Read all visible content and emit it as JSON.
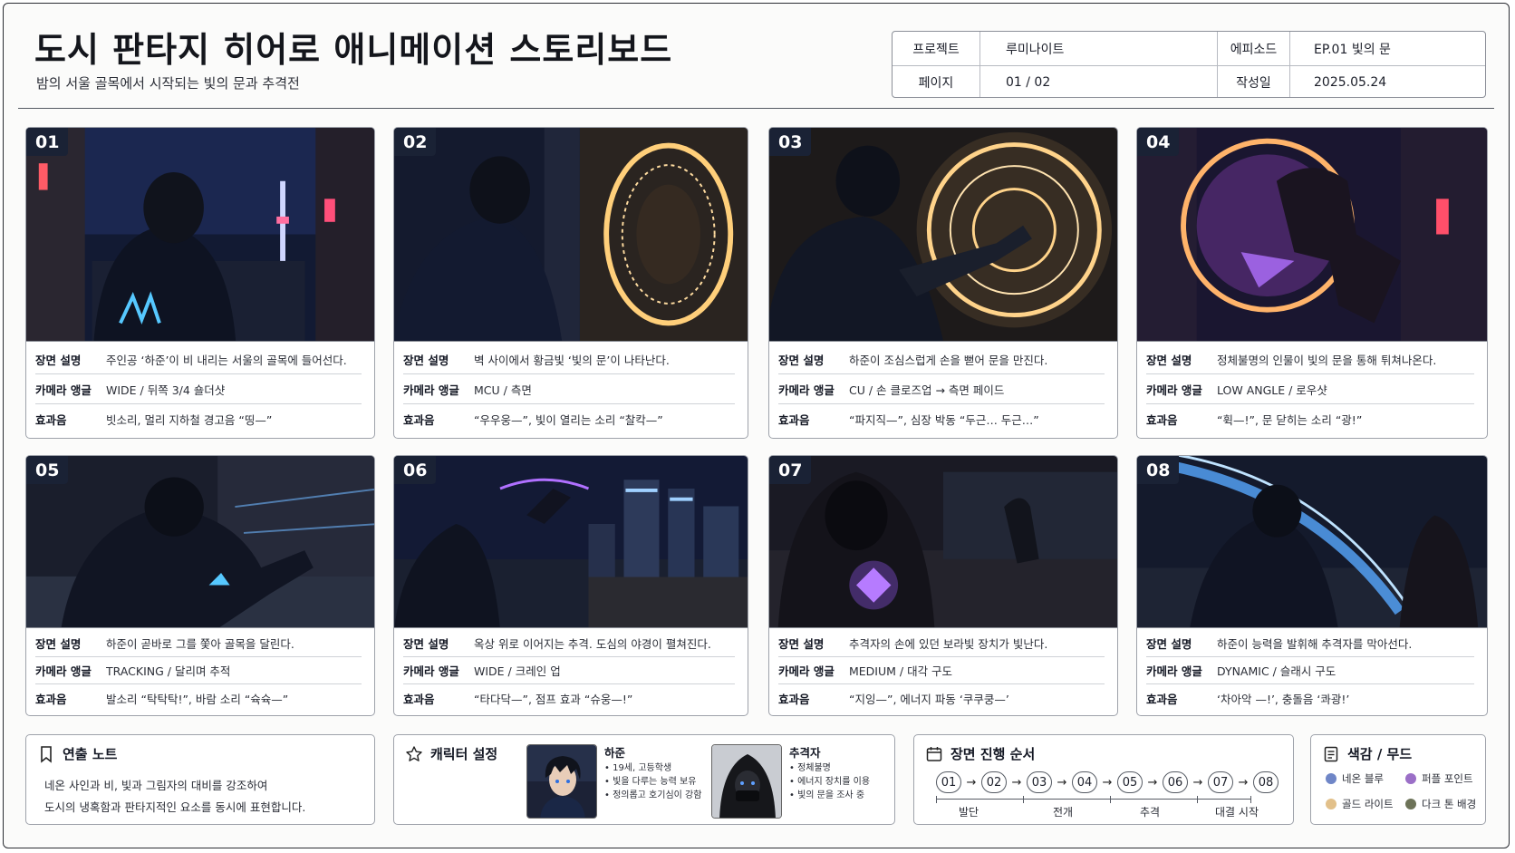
{
  "header": {
    "title": "도시 판타지 히어로 애니메이션 스토리보드",
    "subtitle": "밤의 서울 골목에서 시작되는 빛의 문과 추격전"
  },
  "meta": {
    "project_label": "프로젝트",
    "project_value": "루미나이트",
    "episode_label": "에피소드",
    "episode_value": "EP.01 빛의 문",
    "page_label": "페이지",
    "page_value": "01 / 02",
    "date_label": "작성일",
    "date_value": "2025.05.24"
  },
  "labels": {
    "scene": "장면 설명",
    "camera": "카메라 앵글",
    "sound": "효과음"
  },
  "panels": [
    {
      "num": "01",
      "scene": "주인공 ‘하준’이 비 내리는 서울의 골목에 들어선다.",
      "camera": "WIDE / 뒤쪽 3/4 숄더샷",
      "sound": "빗소리, 멀리 지하철 경고음 “띵—”"
    },
    {
      "num": "02",
      "scene": "벽 사이에서 황금빛 ‘빛의 문’이 나타난다.",
      "camera": "MCU / 측면",
      "sound": "“우우웅—”, 빛이 열리는 소리 “찰칵—”"
    },
    {
      "num": "03",
      "scene": "하준이 조심스럽게 손을 뻗어 문을 만진다.",
      "camera": "CU / 손 클로즈업 → 측면 페이드",
      "sound": "“파지직—”, 심장 박동 “두근… 두근…”"
    },
    {
      "num": "04",
      "scene": "정체불명의 인물이 빛의 문을 통해 튀쳐나온다.",
      "camera": "LOW ANGLE / 로우샷",
      "sound": "“휙—!”, 문 닫히는 소리 “광!”"
    },
    {
      "num": "05",
      "scene": "하준이 곧바로 그를 쫓아 골목을 달린다.",
      "camera": "TRACKING / 달리며 추적",
      "sound": "발소리 “탁탁탁!”, 바람 소리 “슉슉—”"
    },
    {
      "num": "06",
      "scene": "옥상 위로 이어지는 추격. 도심의 야경이 펼쳐진다.",
      "camera": "WIDE / 크레인 업",
      "sound": "“타다닥—”, 점프 효과 “슈웅—!”"
    },
    {
      "num": "07",
      "scene": "추격자의 손에 있던 보라빛 장치가 빛난다.",
      "camera": "MEDIUM / 대각 구도",
      "sound": "“지잉—”, 에너지 파동 ‘쿠쿠쿵—’"
    },
    {
      "num": "08",
      "scene": "하준이 능력을 발휘해 추격자를 막아선다.",
      "camera": "DYNAMIC / 슬래시 구도",
      "sound": "‘차아악 —!’, 충돌음 ‘콰광!’"
    }
  ],
  "notes": {
    "title": "연출 노트",
    "line1": "네온 사인과 비, 빛과 그림자의 대비를 강조하여",
    "line2": "도시의 냉혹함과 판타지적인 요소를 동시에 표현합니다."
  },
  "characters": {
    "title": "캐릭터 설정",
    "list": [
      {
        "name": "하준",
        "lines": [
          "• 19세, 고등학생",
          "• 빛을 다루는 능력 보유",
          "• 정의롭고 호기심이 강함"
        ]
      },
      {
        "name": "추격자",
        "lines": [
          "• 정체불명",
          "• 에너지 장치를 이용",
          "• 빛의 문을 조사 중"
        ]
      }
    ]
  },
  "sequence": {
    "title": "장면 진행 순서",
    "steps": [
      "01",
      "02",
      "03",
      "04",
      "05",
      "06",
      "07",
      "08"
    ],
    "arrow": "→",
    "phases": [
      "발단",
      "전개",
      "추격",
      "대결 시작"
    ]
  },
  "mood": {
    "title": "색감 / 무드",
    "swatches": [
      {
        "label": "네온 블루",
        "color": "#6f86c7"
      },
      {
        "label": "퍼플 포인트",
        "color": "#9b6fc7"
      },
      {
        "label": "골드 라이트",
        "color": "#e2c08a"
      },
      {
        "label": "다크 톤 배경",
        "color": "#6d7358"
      }
    ]
  }
}
